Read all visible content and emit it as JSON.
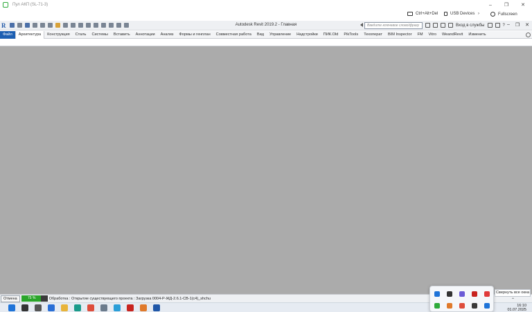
{
  "rdp": {
    "title": "Пул АКП (SL-71-3)",
    "controls": {
      "hotkey": "Ctrl+Alt+Del",
      "usb": "USB Devices",
      "fullscreen": "Fullscreen"
    },
    "window_controls": [
      "–",
      "❐",
      "✕"
    ]
  },
  "revit": {
    "logo": "R",
    "title": "Autodesk Revit 2019.2 - Главная",
    "search_placeholder": "Введите ключевое слово/фразу",
    "signin": "Вход в службы",
    "help": "?",
    "window_controls": [
      "–",
      "❐",
      "✕"
    ]
  },
  "ribbon": {
    "tabs": [
      "Файл",
      "Архитектура",
      "Конструкция",
      "Сталь",
      "Системы",
      "Вставить",
      "Аннотации",
      "Анализ",
      "Формы и генплан",
      "Совместная работа",
      "Вид",
      "Управление",
      "Надстройки",
      "ПИК.Old",
      "PikTools",
      "Техоперат",
      "BIM Inspector",
      "FM",
      "Vitro",
      "WeandRevit",
      "Изменить"
    ],
    "active_tab_index": 1
  },
  "status": {
    "cancel_label": "Отмена",
    "progress_percent": 75,
    "progress_text": "75 %",
    "message": "Обработка : Открытие существующего проекта : Загрузка 0004-Р-ЖД-2.6.1-СВ-1(с4)_shchu"
  },
  "tray": {
    "minimize_all_label": "Свернуть все окна",
    "time": "16:10",
    "date": "01.07.2025",
    "tray_icons_row1": [
      "bluetooth-icon",
      "agent-icon",
      "notes-icon",
      "vpn-icon",
      "yandex-icon"
    ],
    "tray_icons_row2": [
      "rdp-icon",
      "office-icon",
      "chrome-icon",
      "nvidia-icon",
      "network-icon"
    ]
  },
  "taskbar": {
    "icons": [
      "windows-start-icon",
      "search-icon",
      "task-view-icon",
      "yandex-browser-icon",
      "file-explorer-icon",
      "edge-icon",
      "chrome-icon",
      "calculator-icon",
      "telegram-icon",
      "acrobat-icon",
      "app-icon",
      "revit-icon"
    ]
  },
  "colors": {
    "accent": "#1d5fb2",
    "canvas": "#ababab",
    "progress": "#2aa52a",
    "rdp_green": "#2eaa3a"
  }
}
